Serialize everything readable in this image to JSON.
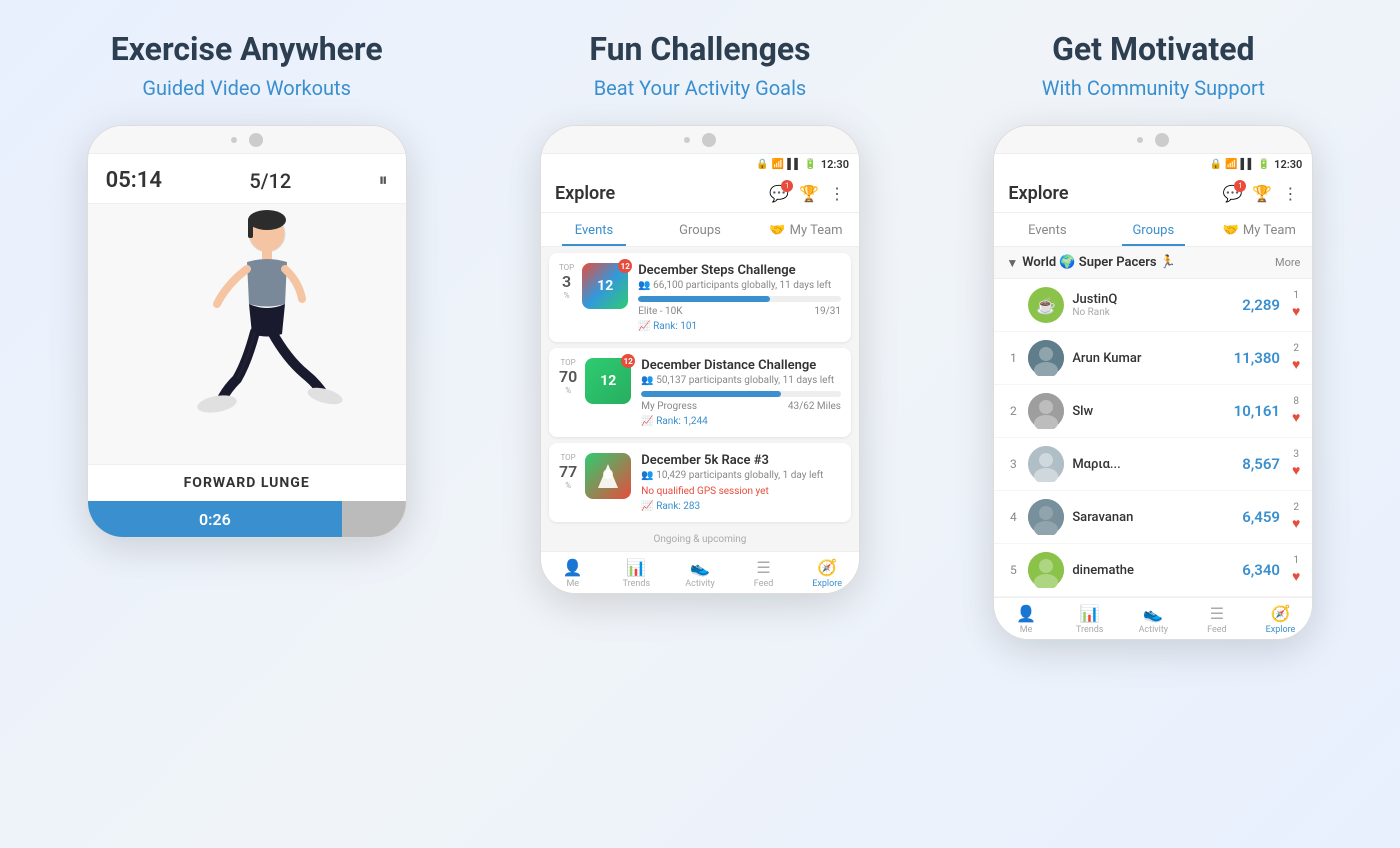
{
  "sections": [
    {
      "id": "exercise",
      "title": "Exercise Anywhere",
      "subtitle": "Guided Video Workouts",
      "phone": {
        "timer": "05:14",
        "count": "5/12",
        "exercise_name": "FORWARD LUNGE",
        "progress_time": "0:26"
      }
    },
    {
      "id": "challenges",
      "title": "Fun Challenges",
      "subtitle": "Beat Your Activity Goals",
      "phone": {
        "status_time": "12:30",
        "app_title": "Explore",
        "tabs": [
          "Events",
          "Groups",
          "My Team"
        ],
        "challenges": [
          {
            "title": "December Steps Challenge",
            "participants": "66,100 participants globally, 11 days left",
            "progress": 65,
            "elite": "Elite - 10K",
            "progress_val": "19/31",
            "top_pct": "3",
            "rank": "Rank: 101"
          },
          {
            "title": "December Distance Challenge",
            "participants": "50,137 participants globally, 11 days left",
            "progress": 70,
            "elite": "My Progress",
            "progress_val": "43/62 Miles",
            "top_pct": "70",
            "rank": "Rank: 1,244"
          },
          {
            "title": "December 5k Race #3",
            "participants": "10,429 participants globally, 1 day left",
            "progress": 0,
            "elite": "No qualified GPS session yet",
            "progress_val": "",
            "top_pct": "77",
            "rank": "Rank: 283"
          }
        ],
        "ongoing_label": "Ongoing & upcoming",
        "nav_items": [
          "Me",
          "Trends",
          "Activity",
          "Feed",
          "Explore"
        ]
      }
    },
    {
      "id": "community",
      "title": "Get Motivated",
      "subtitle": "With Community Support",
      "phone": {
        "status_time": "12:30",
        "app_title": "Explore",
        "tabs": [
          "Events",
          "Groups",
          "My Team"
        ],
        "active_tab": "Groups",
        "group_title": "World 🌍 Super Pacers 🏃",
        "leaders": [
          {
            "rank": "",
            "name": "JustinQ",
            "sub": "No Rank",
            "score": "2,289",
            "badge_rank": "1",
            "avatar_color": "#8BC34A",
            "avatar_emoji": "☕"
          },
          {
            "rank": "1",
            "name": "Arun Kumar",
            "sub": "",
            "score": "11,380",
            "badge_rank": "2",
            "avatar_color": "#607D8B",
            "avatar_emoji": "👤"
          },
          {
            "rank": "2",
            "name": "Slw",
            "sub": "",
            "score": "10,161",
            "badge_rank": "8",
            "avatar_color": "#9E9E9E",
            "avatar_emoji": "👤"
          },
          {
            "rank": "3",
            "name": "Μαρια...",
            "sub": "",
            "score": "8,567",
            "badge_rank": "3",
            "avatar_color": "#B0BEC5",
            "avatar_emoji": "👤"
          },
          {
            "rank": "4",
            "name": "Saravanan",
            "sub": "",
            "score": "6,459",
            "badge_rank": "2",
            "avatar_color": "#78909C",
            "avatar_emoji": "👤"
          },
          {
            "rank": "5",
            "name": "dinemathe",
            "sub": "",
            "score": "6,340",
            "badge_rank": "1",
            "avatar_color": "#8BC34A",
            "avatar_emoji": "👤"
          }
        ],
        "nav_items": [
          "Me",
          "Trends",
          "Activity",
          "Feed",
          "Explore"
        ]
      }
    }
  ],
  "colors": {
    "blue": "#3a8fcf",
    "dark": "#2c3e50",
    "red": "#e74c3c",
    "green": "#4CAF50"
  }
}
